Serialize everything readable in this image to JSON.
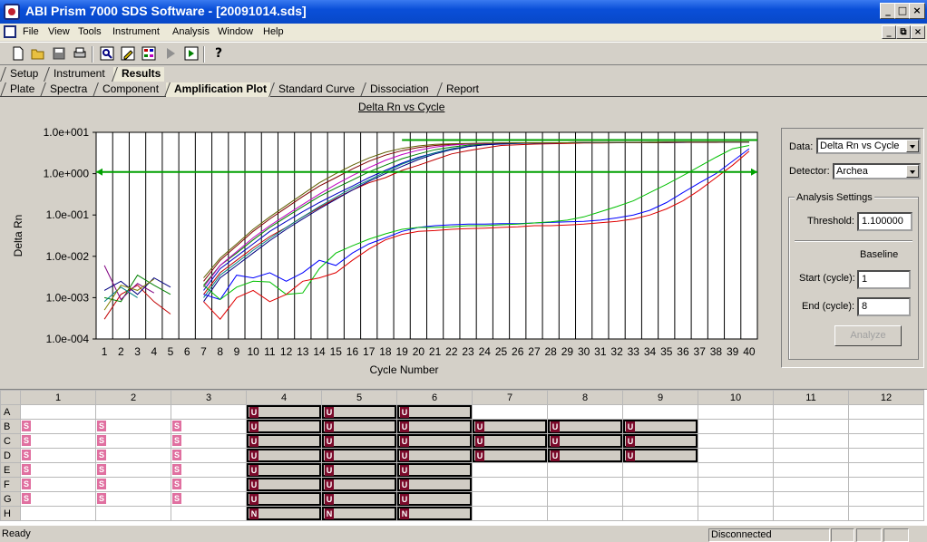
{
  "window": {
    "title": "ABI Prism 7000 SDS Software - [20091014.sds]",
    "controls": [
      "_",
      "□",
      "×"
    ],
    "mdi_controls": [
      "_",
      "⧉",
      "×"
    ]
  },
  "menu": [
    "File",
    "View",
    "Tools",
    "Instrument",
    "Analysis",
    "Window",
    "Help"
  ],
  "toolbar": {
    "icons": [
      "new-document-icon",
      "open-folder-icon",
      "save-icon",
      "print-icon",
      "zoom-icon",
      "edit-icon",
      "plate-layout-icon",
      "run-icon",
      "run-instrument-icon",
      "help-icon"
    ],
    "help_label": "?"
  },
  "main_tabs": [
    "Setup",
    "Instrument",
    "Results"
  ],
  "sub_tabs": [
    "Plate",
    "Spectra",
    "Component",
    "Amplification Plot",
    "Standard Curve",
    "Dissociation",
    "Report"
  ],
  "chart_title": "Delta Rn vs Cycle",
  "side": {
    "data_label": "Data:",
    "data_value": "Delta Rn vs Cycle",
    "detector_label": "Detector:",
    "detector_value": "Archea",
    "group_title": "Analysis Settings",
    "threshold_label": "Threshold:",
    "threshold_value": "1.100000",
    "baseline_label": "Baseline",
    "start_label": "Start (cycle):",
    "start_value": "1",
    "end_label": "End (cycle):",
    "end_value": "8",
    "analyze_label": "Analyze"
  },
  "plate": {
    "columns": [
      "1",
      "2",
      "3",
      "4",
      "5",
      "6",
      "7",
      "8",
      "9",
      "10",
      "11",
      "12"
    ],
    "rows": [
      "A",
      "B",
      "C",
      "D",
      "E",
      "F",
      "G",
      "H"
    ],
    "wells": [
      [
        "",
        "",
        "",
        "U",
        "U",
        "U",
        "",
        "",
        "",
        "",
        "",
        ""
      ],
      [
        "S",
        "S",
        "S",
        "U",
        "U",
        "U",
        "U",
        "U",
        "U",
        "",
        "",
        ""
      ],
      [
        "S",
        "S",
        "S",
        "U",
        "U",
        "U",
        "U",
        "U",
        "U",
        "",
        "",
        ""
      ],
      [
        "S",
        "S",
        "S",
        "U",
        "U",
        "U",
        "U",
        "U",
        "U",
        "",
        "",
        ""
      ],
      [
        "S",
        "S",
        "S",
        "U",
        "U",
        "U",
        "",
        "",
        "",
        "",
        "",
        ""
      ],
      [
        "S",
        "S",
        "S",
        "U",
        "U",
        "U",
        "",
        "",
        "",
        "",
        "",
        ""
      ],
      [
        "S",
        "S",
        "S",
        "U",
        "U",
        "U",
        "",
        "",
        "",
        "",
        "",
        ""
      ],
      [
        "",
        "",
        "",
        "N",
        "N",
        "N",
        "",
        "",
        "",
        "",
        "",
        ""
      ]
    ]
  },
  "status": {
    "left": "Ready",
    "right": "Disconnected"
  },
  "chart_data": {
    "type": "line",
    "title": "Delta Rn vs Cycle",
    "xlabel": "Cycle Number",
    "ylabel": "Delta Rn",
    "xlim": [
      1,
      40
    ],
    "ylim": [
      0.0001,
      10
    ],
    "log_y": true,
    "y_ticks": [
      "1.0e+001",
      "1.0e+000",
      "1.0e-001",
      "1.0e-002",
      "1.0e-003",
      "1.0e-004"
    ],
    "x_ticks": [
      "1",
      "2",
      "3",
      "4",
      "5",
      "6",
      "7",
      "8",
      "9",
      "10",
      "11",
      "12",
      "13",
      "14",
      "15",
      "16",
      "17",
      "18",
      "19",
      "20",
      "21",
      "22",
      "23",
      "24",
      "25",
      "26",
      "27",
      "28",
      "29",
      "30",
      "31",
      "32",
      "33",
      "34",
      "35",
      "36",
      "37",
      "38",
      "39",
      "40"
    ],
    "grid": "vertical",
    "threshold": 1.1,
    "threshold_color": "#00a000",
    "series": [
      {
        "color": "#c00000",
        "x": [
          1,
          2,
          3,
          4,
          5
        ],
        "y": [
          0.0003,
          0.0012,
          0.002,
          0.0008,
          0.0004
        ]
      },
      {
        "color": "#008000",
        "x": [
          1,
          2,
          3,
          4,
          5
        ],
        "y": [
          0.001,
          0.0008,
          0.0035,
          0.002,
          0.0012
        ]
      },
      {
        "color": "#000080",
        "x": [
          1,
          2,
          3,
          4,
          5
        ],
        "y": [
          0.0015,
          0.0025,
          0.0012,
          0.003,
          0.0018
        ]
      },
      {
        "color": "#800080",
        "x": [
          1,
          2,
          3,
          4
        ],
        "y": [
          0.006,
          0.0009,
          0.0022,
          0.0013
        ]
      },
      {
        "color": "#008080",
        "x": [
          1,
          2,
          3
        ],
        "y": [
          0.0008,
          0.0018,
          0.001
        ]
      },
      {
        "color": "#808000",
        "x": [
          1,
          2,
          3,
          4
        ],
        "y": [
          0.0005,
          0.002,
          0.0015,
          0.0028
        ]
      },
      {
        "color": "#c00000",
        "x": [
          7,
          8,
          9,
          10,
          11,
          12,
          13,
          14,
          15,
          16,
          17,
          18,
          19,
          20,
          21,
          22,
          23,
          24,
          25,
          26,
          27,
          28,
          29,
          30,
          31,
          32,
          33,
          34,
          35,
          36,
          37,
          38,
          39,
          40
        ],
        "y": [
          0.0012,
          0.004,
          0.008,
          0.016,
          0.03,
          0.05,
          0.09,
          0.15,
          0.25,
          0.4,
          0.6,
          0.8,
          1.2,
          1.6,
          2.2,
          3,
          3.6,
          4.2,
          4.8,
          5,
          5.2,
          5.3,
          5.4,
          5.5,
          5.5,
          5.6,
          5.6,
          5.6,
          5.6,
          5.7,
          5.7,
          5.7,
          5.8,
          5.8
        ]
      },
      {
        "color": "#0000c0",
        "x": [
          7,
          8,
          9,
          10,
          11,
          12,
          13,
          14,
          15,
          16,
          17,
          18,
          19,
          20,
          21,
          22,
          23,
          24,
          25,
          26,
          27,
          28,
          29,
          30,
          31,
          32,
          33,
          34,
          35,
          36,
          37,
          38,
          39,
          40
        ],
        "y": [
          0.0015,
          0.005,
          0.01,
          0.02,
          0.04,
          0.07,
          0.12,
          0.2,
          0.32,
          0.5,
          0.8,
          1.2,
          1.8,
          2.5,
          3.2,
          4,
          4.6,
          5,
          5.2,
          5.4,
          5.5,
          5.5,
          5.6,
          5.6,
          5.6,
          5.6,
          5.7,
          5.7,
          5.7,
          5.7,
          5.8,
          5.8,
          5.8,
          5.8
        ]
      },
      {
        "color": "#008000",
        "x": [
          7,
          8,
          9,
          10,
          11,
          12,
          13,
          14,
          15,
          16,
          17,
          18,
          19,
          20,
          21,
          22,
          23,
          24,
          25,
          26,
          27,
          28,
          29,
          30,
          31,
          32,
          33,
          34,
          35,
          36,
          37,
          38,
          39,
          40
        ],
        "y": [
          0.002,
          0.006,
          0.012,
          0.025,
          0.05,
          0.09,
          0.16,
          0.28,
          0.45,
          0.7,
          1.1,
          1.6,
          2.3,
          3,
          3.8,
          4.4,
          4.9,
          5.2,
          5.4,
          5.5,
          5.6,
          5.6,
          5.6,
          5.7,
          5.7,
          5.7,
          5.7,
          5.8,
          5.8,
          5.8,
          5.8,
          5.8,
          5.8,
          5.8
        ]
      },
      {
        "color": "#800000",
        "x": [
          7,
          8,
          9,
          10,
          11,
          12,
          13,
          14,
          15,
          16,
          17,
          18,
          19,
          20,
          21,
          22,
          23,
          24,
          25,
          26,
          27,
          28,
          29,
          30,
          31,
          32,
          33,
          34,
          35,
          36,
          37,
          38,
          39,
          40
        ],
        "y": [
          0.0025,
          0.008,
          0.018,
          0.04,
          0.08,
          0.15,
          0.28,
          0.5,
          0.8,
          1.3,
          2,
          2.8,
          3.6,
          4.3,
          4.8,
          5.1,
          5.3,
          5.4,
          5.5,
          5.5,
          5.6,
          5.6,
          5.6,
          5.6,
          5.7,
          5.7,
          5.7,
          5.7,
          5.7,
          5.8,
          5.8,
          5.8,
          5.8,
          5.8
        ]
      },
      {
        "color": "#008080",
        "x": [
          7,
          8,
          9,
          10,
          11,
          12,
          13,
          14,
          15,
          16,
          17,
          18,
          19,
          20,
          21,
          22,
          23,
          24,
          25,
          26,
          27,
          28,
          29,
          30,
          31,
          32,
          33,
          34,
          35,
          36,
          37,
          38,
          39,
          40
        ],
        "y": [
          0.001,
          0.0035,
          0.007,
          0.014,
          0.027,
          0.05,
          0.09,
          0.16,
          0.27,
          0.45,
          0.7,
          1.1,
          1.7,
          2.4,
          3.2,
          4,
          4.6,
          5,
          5.3,
          5.4,
          5.5,
          5.6,
          5.6,
          5.6,
          5.6,
          5.7,
          5.7,
          5.7,
          5.7,
          5.8,
          5.8,
          5.8,
          5.8,
          5.8
        ]
      },
      {
        "color": "#c000c0",
        "x": [
          7,
          8,
          9,
          10,
          11,
          12,
          13,
          14,
          15,
          16,
          17,
          18,
          19,
          20,
          21,
          22,
          23,
          24,
          25,
          26,
          27,
          28,
          29,
          30,
          31,
          32,
          33,
          34,
          35,
          36,
          37,
          38,
          39,
          40
        ],
        "y": [
          0.0018,
          0.006,
          0.013,
          0.028,
          0.055,
          0.1,
          0.18,
          0.32,
          0.55,
          0.9,
          1.4,
          2.1,
          2.9,
          3.7,
          4.4,
          4.9,
          5.2,
          5.4,
          5.5,
          5.5,
          5.6,
          5.6,
          5.6,
          5.7,
          5.7,
          5.7,
          5.7,
          5.7,
          5.8,
          5.8,
          5.8,
          5.8,
          5.8,
          5.8
        ]
      },
      {
        "color": "#000080",
        "x": [
          7,
          8,
          9,
          10,
          11,
          12,
          13,
          14,
          15,
          16,
          17,
          18,
          19,
          20,
          21,
          22,
          23,
          24,
          25,
          26,
          27,
          28,
          29,
          30,
          31,
          32,
          33,
          34,
          35,
          36,
          37,
          38,
          39,
          40
        ],
        "y": [
          0.0008,
          0.003,
          0.006,
          0.012,
          0.024,
          0.045,
          0.08,
          0.14,
          0.24,
          0.4,
          0.65,
          1,
          1.5,
          2.2,
          3,
          3.8,
          4.5,
          5,
          5.3,
          5.5,
          5.5,
          5.6,
          5.6,
          5.6,
          5.7,
          5.7,
          5.7,
          5.7,
          5.8,
          5.8,
          5.8,
          5.8,
          5.8,
          5.8
        ]
      },
      {
        "color": "#606000",
        "x": [
          7,
          8,
          9,
          10,
          11,
          12,
          13,
          14,
          15,
          16,
          17,
          18,
          19,
          20,
          21,
          22,
          23,
          24,
          25,
          26,
          27,
          28,
          29,
          30,
          31,
          32,
          33,
          34,
          35,
          36,
          37,
          38,
          39,
          40
        ],
        "y": [
          0.003,
          0.009,
          0.02,
          0.045,
          0.09,
          0.17,
          0.32,
          0.6,
          1,
          1.6,
          2.4,
          3.3,
          4.1,
          4.7,
          5.1,
          5.3,
          5.4,
          5.5,
          5.5,
          5.6,
          5.6,
          5.6,
          5.6,
          5.7,
          5.7,
          5.7,
          5.7,
          5.7,
          5.8,
          5.8,
          5.8,
          5.8,
          5.8,
          5.8
        ]
      },
      {
        "color": "#0000ff",
        "x": [
          7,
          8,
          9,
          10,
          11,
          12,
          13,
          14,
          15,
          16,
          17,
          18,
          19,
          20,
          21,
          22,
          23,
          24,
          25,
          26,
          27,
          28,
          29,
          30,
          31,
          32,
          33,
          34,
          35,
          36,
          37,
          38,
          39,
          40
        ],
        "y": [
          0.0012,
          0.0009,
          0.0035,
          0.003,
          0.004,
          0.0025,
          0.004,
          0.008,
          0.006,
          0.012,
          0.02,
          0.028,
          0.04,
          0.05,
          0.055,
          0.058,
          0.06,
          0.06,
          0.062,
          0.062,
          0.064,
          0.066,
          0.068,
          0.07,
          0.075,
          0.085,
          0.1,
          0.13,
          0.2,
          0.35,
          0.6,
          1,
          2,
          4
        ]
      },
      {
        "color": "#00c000",
        "x": [
          7,
          8,
          9,
          10,
          11,
          12,
          13,
          14,
          15,
          16,
          17,
          18,
          19,
          20,
          21,
          22,
          23,
          24,
          25,
          26,
          27,
          28,
          29,
          30,
          31,
          32,
          33,
          34,
          35,
          36,
          37,
          38,
          39,
          40
        ],
        "y": [
          0.002,
          0.0009,
          0.0018,
          0.0025,
          0.0024,
          0.0012,
          0.0013,
          0.005,
          0.012,
          0.018,
          0.026,
          0.035,
          0.045,
          0.05,
          0.05,
          0.052,
          0.055,
          0.055,
          0.058,
          0.06,
          0.064,
          0.068,
          0.075,
          0.09,
          0.12,
          0.16,
          0.22,
          0.35,
          0.55,
          0.9,
          1.5,
          2.5,
          4,
          4.8
        ]
      },
      {
        "color": "#e00000",
        "x": [
          7,
          8,
          9,
          10,
          11,
          12,
          13,
          14,
          15,
          16,
          17,
          18,
          19,
          20,
          21,
          22,
          23,
          24,
          25,
          26,
          27,
          28,
          29,
          30,
          31,
          32,
          33,
          34,
          35,
          36,
          37,
          38,
          39,
          40
        ],
        "y": [
          0.0008,
          0.0003,
          0.001,
          0.0015,
          0.0008,
          0.0012,
          0.0025,
          0.003,
          0.004,
          0.008,
          0.015,
          0.025,
          0.034,
          0.04,
          0.042,
          0.045,
          0.047,
          0.048,
          0.05,
          0.052,
          0.055,
          0.055,
          0.057,
          0.06,
          0.065,
          0.07,
          0.08,
          0.1,
          0.14,
          0.22,
          0.4,
          0.8,
          1.6,
          3.5
        ]
      }
    ]
  }
}
